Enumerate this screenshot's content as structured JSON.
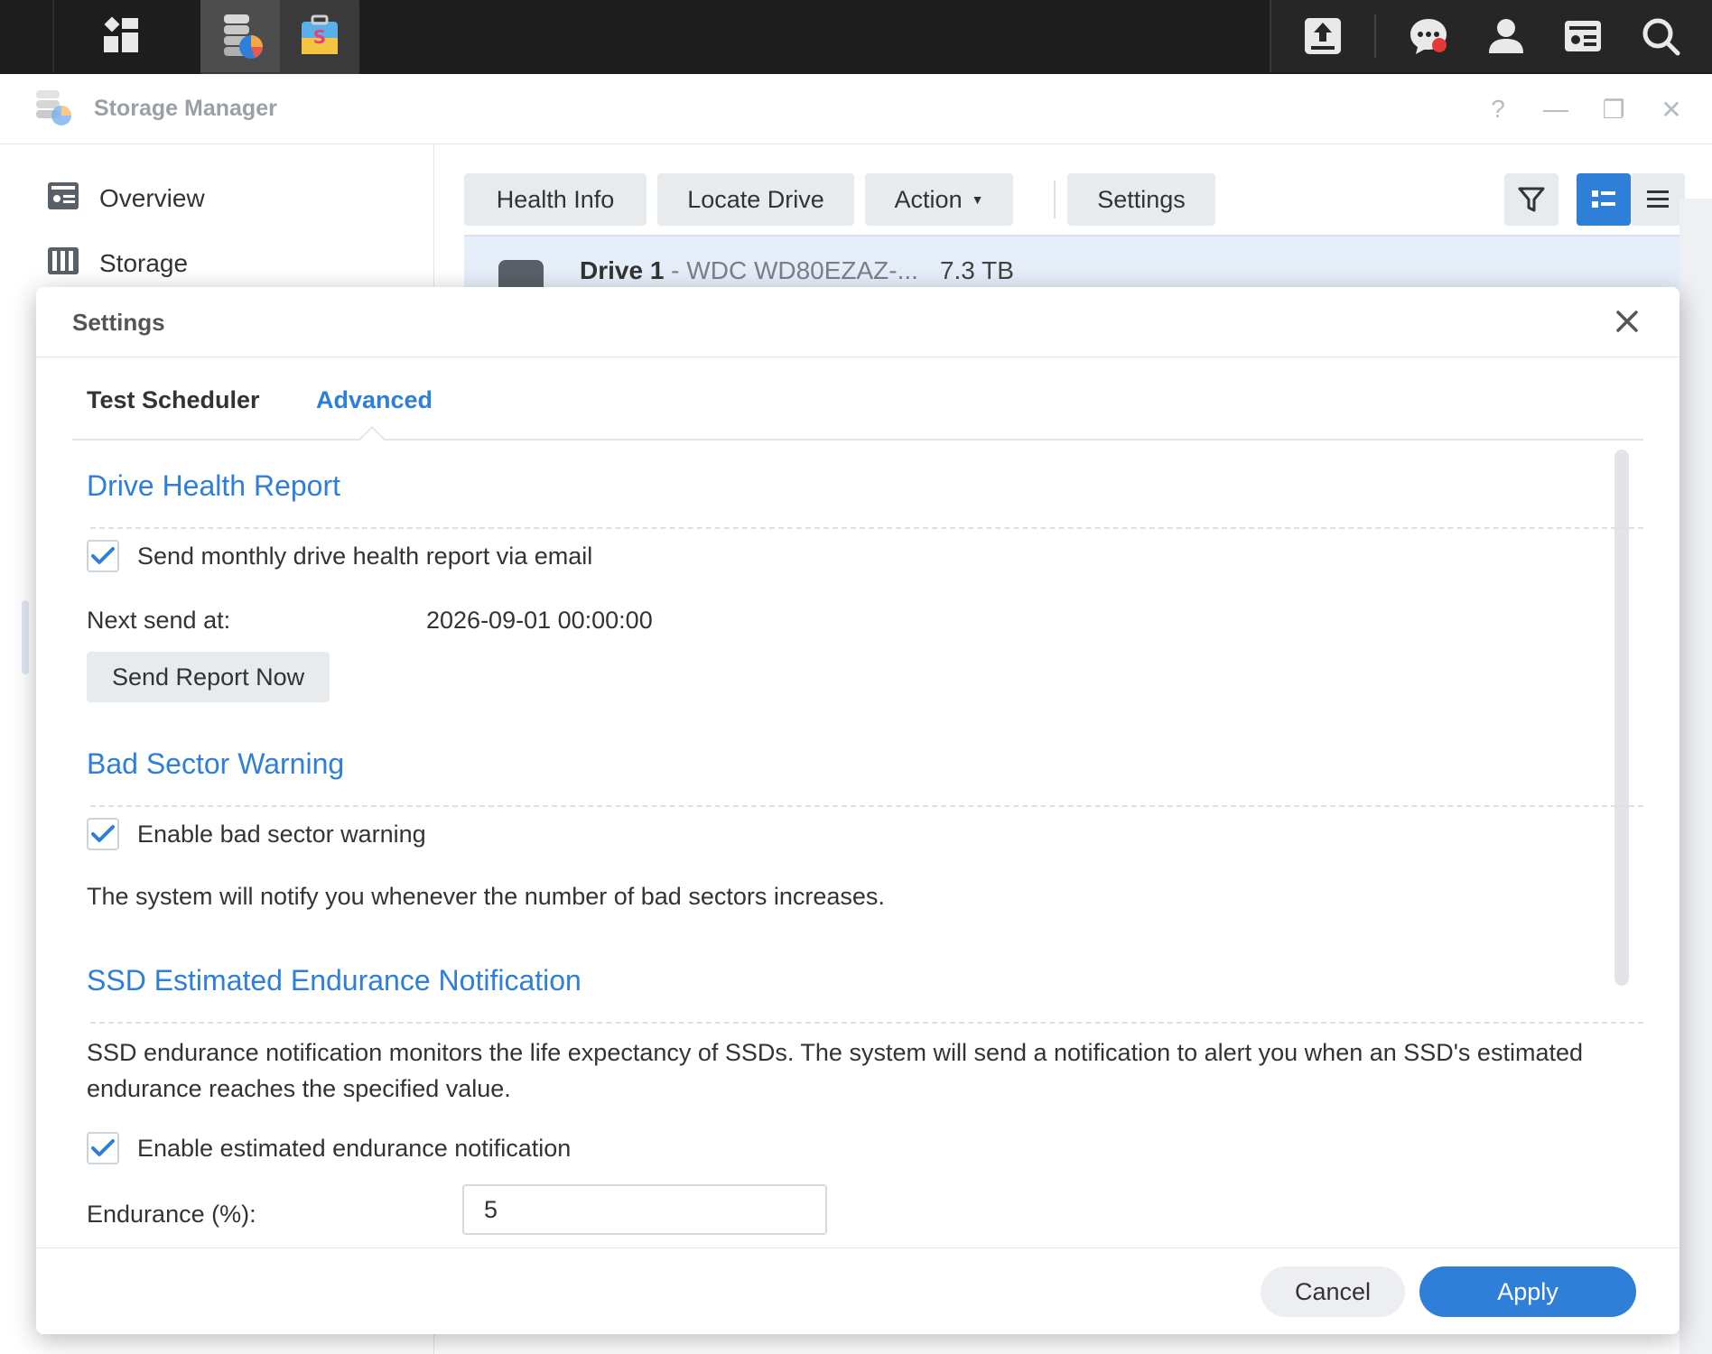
{
  "taskbar": {
    "apps": [
      "main-menu-icon",
      "storage-manager-icon",
      "package-center-icon"
    ],
    "tray": [
      "upload-icon",
      "chat-icon",
      "user-icon",
      "widgets-icon",
      "search-icon"
    ]
  },
  "window": {
    "title": "Storage Manager",
    "controls": {
      "help": "?",
      "minimize": "—",
      "maximize": "❐",
      "close": "✕"
    }
  },
  "sidebar": {
    "items": [
      {
        "label": "Overview",
        "icon": "overview-icon"
      },
      {
        "label": "Storage",
        "icon": "storage-icon"
      }
    ]
  },
  "toolbar": {
    "health_info": "Health Info",
    "locate_drive": "Locate Drive",
    "action": "Action",
    "settings": "Settings"
  },
  "drive": {
    "name": "Drive 1",
    "model": " - WDC WD80EZAZ-...",
    "size": "7.3 TB"
  },
  "dialog": {
    "title": "Settings",
    "tabs": [
      "Test Scheduler",
      "Advanced"
    ],
    "active_tab": "Advanced",
    "health_report": {
      "title": "Drive Health Report",
      "checkbox_label": "Send monthly drive health report via email",
      "checked": true,
      "next_send_label": "Next send at:",
      "next_send_value": "2026-09-01 00:00:00",
      "send_now": "Send Report Now"
    },
    "bad_sector": {
      "title": "Bad Sector Warning",
      "checkbox_label": "Enable bad sector warning",
      "checked": true,
      "description": "The system will notify you whenever the number of bad sectors increases."
    },
    "ssd_endurance": {
      "title": "SSD Estimated Endurance Notification",
      "description": "SSD endurance notification monitors the life expectancy of SSDs. The system will send a notification to alert you when an SSD's estimated endurance reaches the specified value.",
      "checkbox_label": "Enable estimated endurance notification",
      "checked": true,
      "endurance_label": "Endurance (%):",
      "endurance_value": "5"
    },
    "cancel": "Cancel",
    "apply": "Apply"
  },
  "colors": {
    "accent": "#2f7ed8",
    "taskbar": "#1d1d1d"
  }
}
